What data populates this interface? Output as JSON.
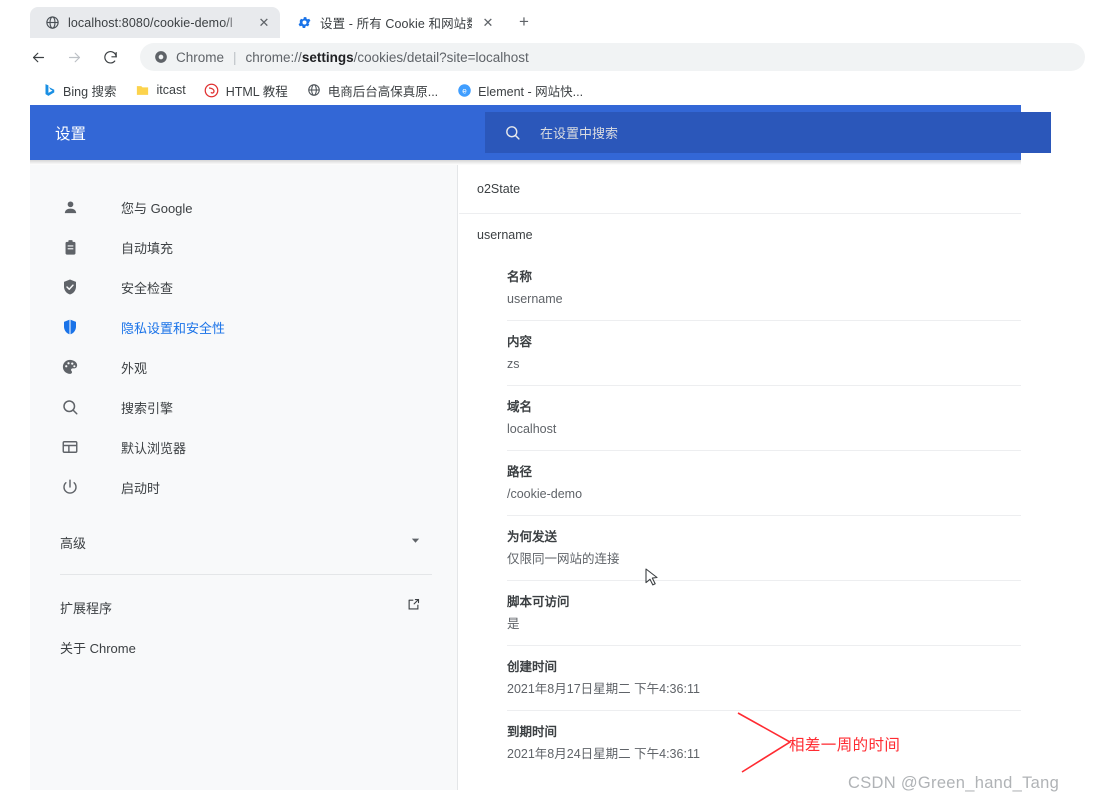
{
  "browser": {
    "tabs": [
      {
        "title": "localhost:8080/cookie-demo/l",
        "favicon": "globe-icon",
        "active": false,
        "close_label": "✕"
      },
      {
        "title": "设置 - 所有 Cookie 和网站数据",
        "favicon": "gear-icon",
        "active": true,
        "close_label": "✕"
      }
    ],
    "new_tab_label": "+",
    "nav": {
      "back_label": "←",
      "forward_label": "→",
      "reload_label": "⟳"
    },
    "omnibox": {
      "scheme_label": "Chrome",
      "separator": "|",
      "url_prefix": "chrome://",
      "url_bold": "settings",
      "url_suffix": "/cookies/detail?site=localhost"
    },
    "bookmarks": [
      {
        "label": "Bing 搜索",
        "icon": "bing-icon"
      },
      {
        "label": "itcast",
        "icon": "folder-icon"
      },
      {
        "label": "HTML 教程",
        "icon": "runoob-icon"
      },
      {
        "label": "电商后台高保真原...",
        "icon": "globe-icon"
      },
      {
        "label": "Element - 网站快...",
        "icon": "element-icon"
      }
    ]
  },
  "settings": {
    "title": "设置",
    "search": {
      "placeholder": "在设置中搜索",
      "icon": "search-icon"
    },
    "accent_color": "#3367d6",
    "search_bg_color": "#2b57ba",
    "sidebar": {
      "items": [
        {
          "label": "您与 Google",
          "icon": "person-icon",
          "selected": false
        },
        {
          "label": "自动填充",
          "icon": "clipboard-icon",
          "selected": false
        },
        {
          "label": "安全检查",
          "icon": "shield-check-icon",
          "selected": false
        },
        {
          "label": "隐私设置和安全性",
          "icon": "shield-icon",
          "selected": true
        },
        {
          "label": "外观",
          "icon": "palette-icon",
          "selected": false
        },
        {
          "label": "搜索引擎",
          "icon": "search-icon",
          "selected": false
        },
        {
          "label": "默认浏览器",
          "icon": "browser-icon",
          "selected": false
        },
        {
          "label": "启动时",
          "icon": "power-icon",
          "selected": false
        }
      ],
      "advanced": {
        "label": "高级",
        "icon": "chevron-down-icon"
      },
      "extensions": {
        "label": "扩展程序",
        "icon": "external-link-icon"
      },
      "about": {
        "label": "关于 Chrome"
      }
    }
  },
  "cookie_detail": {
    "list_rows": [
      {
        "name": "o2State"
      },
      {
        "name": "username"
      }
    ],
    "fields": [
      {
        "label": "名称",
        "value": "username"
      },
      {
        "label": "内容",
        "value": "zs"
      },
      {
        "label": "域名",
        "value": "localhost"
      },
      {
        "label": "路径",
        "value": "/cookie-demo"
      },
      {
        "label": "为何发送",
        "value": "仅限同一网站的连接"
      },
      {
        "label": "脚本可访问",
        "value": "是"
      },
      {
        "label": "创建时间",
        "value": "2021年8月17日星期二 下午4:36:11"
      },
      {
        "label": "到期时间",
        "value": "2021年8月24日星期二 下午4:36:11"
      }
    ]
  },
  "annotation": {
    "text": "相差一周的时间",
    "color": "#ff2b32"
  },
  "watermark": {
    "text": "CSDN @Green_hand_Tang"
  }
}
